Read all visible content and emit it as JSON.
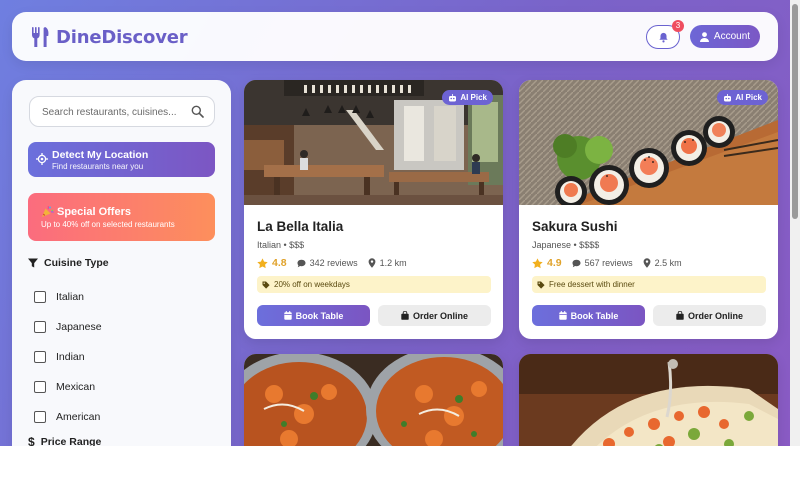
{
  "header": {
    "brand": "DineDiscover",
    "notification_count": "3",
    "account_label": "Account"
  },
  "sidebar": {
    "search_placeholder": "Search restaurants, cuisines...",
    "detect": {
      "title": "Detect My Location",
      "subtitle": "Find restaurants near you"
    },
    "offers": {
      "title": "Special Offers",
      "subtitle": "Up to 40% off on selected restaurants"
    },
    "cuisine_title": "Cuisine Type",
    "cuisines": [
      "Italian",
      "Japanese",
      "Indian",
      "Mexican",
      "American"
    ],
    "price_title": "Price Range"
  },
  "restaurants": [
    {
      "name": "La Bella Italia",
      "subtitle": "Italian • $$$",
      "rating": "4.8",
      "reviews": "342 reviews",
      "distance": "1.2 km",
      "deal": "20% off on weekdays",
      "badge": "AI Pick",
      "book_label": "Book Table",
      "order_label": "Order Online"
    },
    {
      "name": "Sakura Sushi",
      "subtitle": "Japanese • $$$$",
      "rating": "4.9",
      "reviews": "567 reviews",
      "distance": "2.5 km",
      "deal": "Free dessert with dinner",
      "badge": "AI Pick",
      "book_label": "Book Table",
      "order_label": "Order Online"
    }
  ],
  "colors": {
    "brand": "#6a5fc7",
    "accent_gradient_start": "#6c6fdc",
    "accent_gradient_end": "#7b55c2",
    "offer_gradient_start": "#fb6c7e",
    "offer_gradient_end": "#fd8f5c",
    "rating": "#e0a22a",
    "deal_bg": "#fdf3c9",
    "badge_red": "#ef4d5f"
  },
  "icons": {
    "brand": "utensils-icon",
    "notifications": "bell-icon",
    "account": "user-icon",
    "search": "search-icon",
    "location": "crosshair-icon",
    "offers": "party-popper-icon",
    "cuisine": "filter-icon",
    "price": "dollar-icon",
    "rating": "star-icon",
    "reviews": "comment-icon",
    "distance": "map-pin-icon",
    "deal": "tag-icon",
    "book": "calendar-icon",
    "order": "shopping-bag-icon",
    "ai_badge": "robot-icon"
  }
}
